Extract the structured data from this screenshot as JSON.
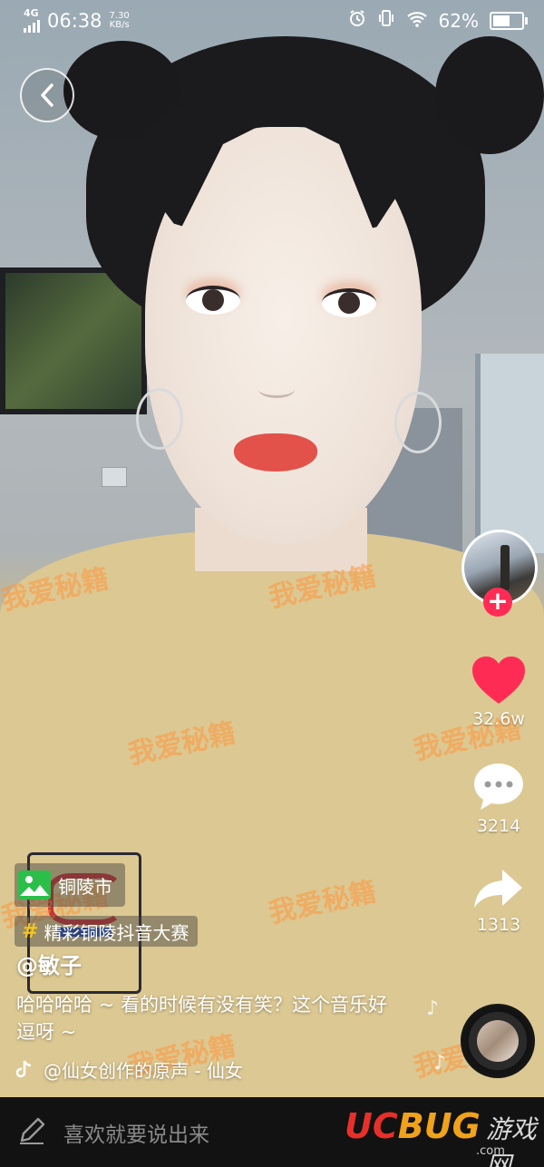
{
  "status_bar": {
    "network_type": "4G",
    "time": "06:38",
    "net_speed_value": "7.30",
    "net_speed_unit": "KB/s",
    "battery": "62%",
    "icons": [
      "signal-icon",
      "alarm-icon",
      "vibrate-icon",
      "wifi-icon",
      "battery-icon"
    ]
  },
  "watermark_text": "我爱秘籍",
  "actions": {
    "likes": "32.6w",
    "comments": "3214",
    "shares": "1313"
  },
  "caption": {
    "location": "铜陵市",
    "challenge": "精彩铜陵抖音大赛",
    "author": "@敏子",
    "description": "哈哈哈哈 ~ 看的时候有没有笑？这个音乐好逗呀 ~",
    "music": "@仙女创作的原声 - 仙女"
  },
  "comment_bar": {
    "placeholder": "喜欢就要说出来"
  },
  "site_logo": {
    "uc": "UC",
    "bug": "BUG",
    "cn": "游戏网",
    "sub": ".com"
  },
  "colors": {
    "like_red": "#fe2c55",
    "follow_red": "#fe2c55",
    "location_green": "#2bbf4a",
    "hash_yellow": "#f5c518"
  }
}
